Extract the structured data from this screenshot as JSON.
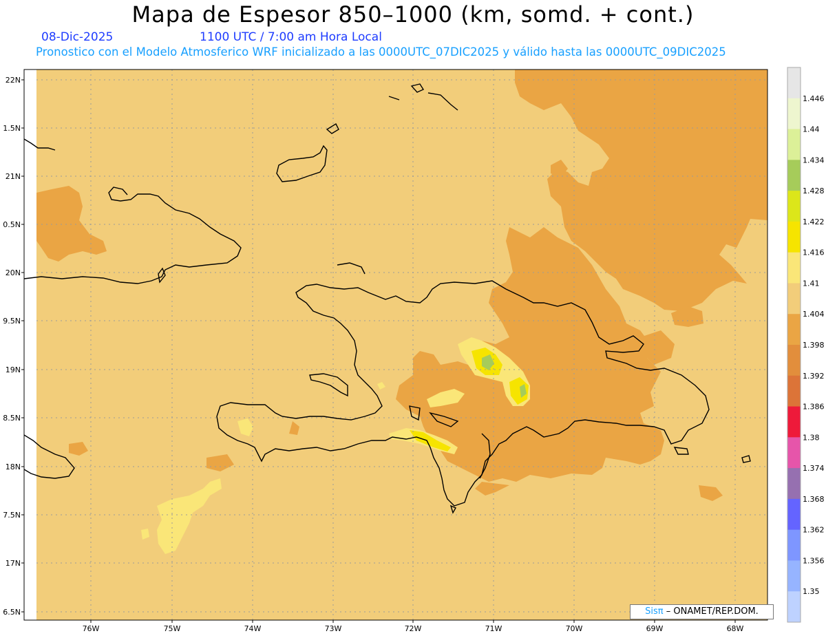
{
  "header": {
    "title": "Mapa de Espesor 850–1000 (km, somd. + cont.)",
    "date": "08-Dic-2025",
    "time": "1100 UTC / 7:00 am Hora Local",
    "description": "Pronostico con el Modelo Atmosferico WRF inicializado a las 0000UTC_07DIC2025 y válido hasta las  0000UTC_09DIC2025"
  },
  "map": {
    "lat_labels": [
      "22N",
      "1.5N",
      "21N",
      "0.5N",
      "20N",
      "9.5N",
      "19N",
      "8.5N",
      "18N",
      "7.5N",
      "17N",
      "6.5N"
    ],
    "lon_labels": [
      "76W",
      "75W",
      "74W",
      "73W",
      "72W",
      "71W",
      "70W",
      "69W",
      "68W"
    ],
    "background_color": "#f2cd7a"
  },
  "legend": {
    "labels": [
      "1.446",
      "1.44",
      "1.434",
      "1.428",
      "1.422",
      "1.416",
      "1.41",
      "1.404",
      "1.398",
      "1.392",
      "1.386",
      "1.38",
      "1.374",
      "1.368",
      "1.362",
      "1.356",
      "1.35"
    ],
    "colors": [
      "#e6e6e6",
      "#eef6cf",
      "#dcf098",
      "#a6cc5a",
      "#dce61a",
      "#f6e400",
      "#fae678",
      "#f2cd7a",
      "#eaa544",
      "#e28e3c",
      "#dc7438",
      "#ee1a3a",
      "#e655aa",
      "#9670b0",
      "#6464ff",
      "#7e96ff",
      "#96b4ff",
      "#bed2ff"
    ]
  },
  "credit": {
    "logo": "Sisπ",
    "text": "– ONAMET/REP.DOM."
  }
}
